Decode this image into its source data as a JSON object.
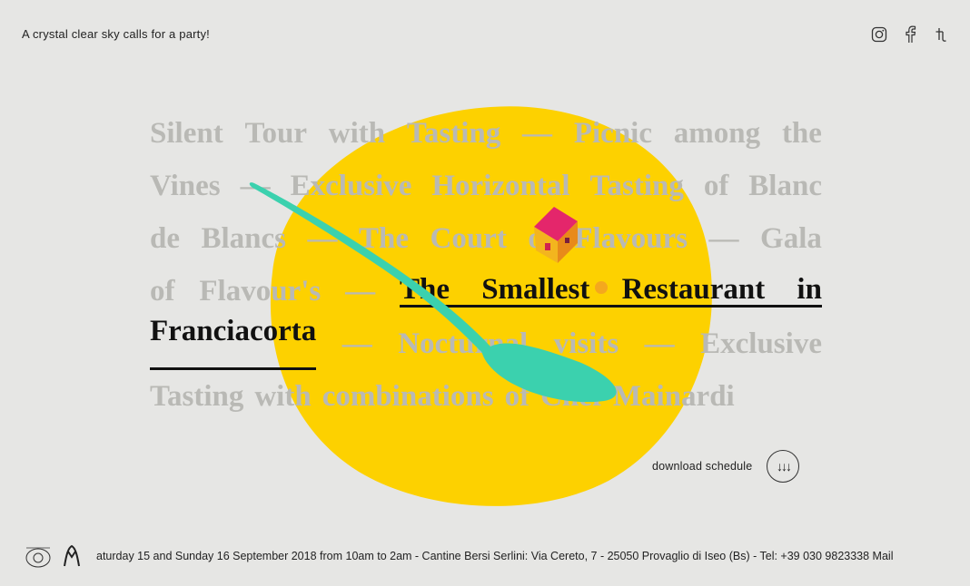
{
  "header": {
    "tagline": "A crystal clear sky calls for a party!",
    "social": [
      {
        "name": "instagram-icon"
      },
      {
        "name": "facebook-icon"
      },
      {
        "name": "tumblr-icon"
      }
    ]
  },
  "menu": {
    "lines": [
      [
        "Silent",
        "Tour",
        "with",
        "Tasting",
        "—",
        "Picnic",
        "among",
        "the"
      ],
      [
        "Vines",
        "—",
        "Exclusive",
        "Horizontal",
        "Tasting",
        "of",
        "Blanc"
      ],
      [
        "de",
        "Blancs",
        "—",
        "The",
        "Court",
        "of",
        "Flavours",
        "—",
        "Gala"
      ],
      [
        "of",
        "Flavour's",
        "—",
        "The",
        "Smallest",
        "Restaurant",
        "in"
      ],
      [
        "Franciacorta",
        "—",
        "Nocturnal",
        "visits",
        "—",
        "Exclusive"
      ],
      [
        "Tasting",
        "with",
        "combinations",
        "of",
        "Chef",
        "Mainardi"
      ]
    ],
    "active_label_line1": "The Smallest Restaurant in",
    "active_label_line2": "Franciacorta"
  },
  "download": {
    "label": "download schedule",
    "icon": "↓↓↓"
  },
  "footer": {
    "ticker": "aturday 15 and Sunday 16 September 2018 from 10am to 2am - Cantine Bersi Serlini: Via Cereto, 7 - 25050 Provaglio di Iseo (Bs) - Tel: +39 030 9823338 Mail"
  },
  "colors": {
    "background": "#e6e6e4",
    "blob": "#fdd100",
    "spoon": "#3bd1ae",
    "muted_text": "#b9b9b5",
    "active_text": "#111111"
  }
}
